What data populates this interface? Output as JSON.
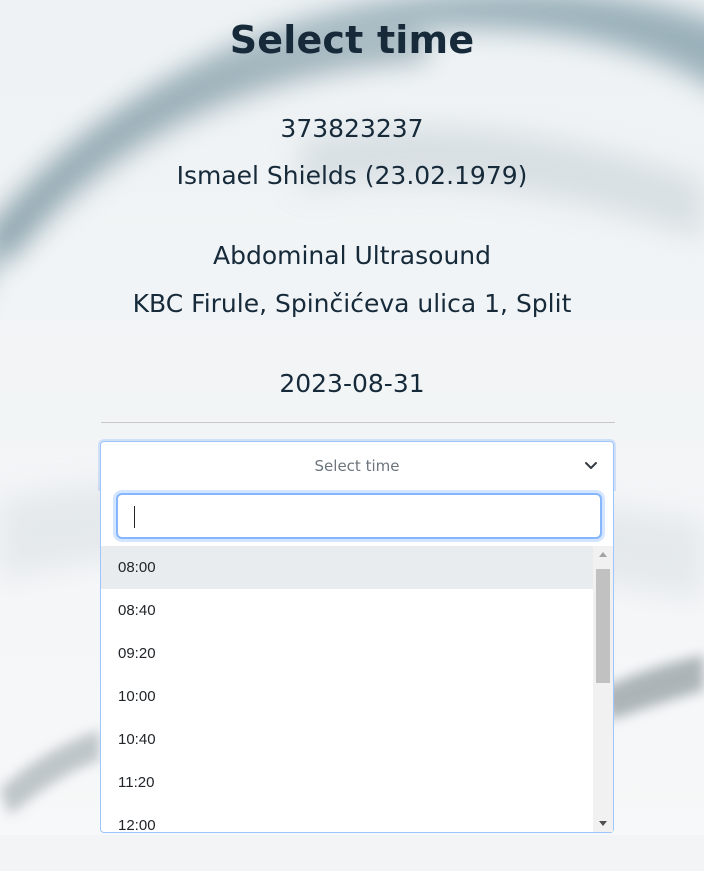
{
  "header": {
    "title": "Select time",
    "patient_id": "373823237",
    "patient_name_dob": "Ismael Shields (23.02.1979)",
    "procedure": "Abdominal Ultrasound",
    "location": "KBC Firule, Spinčićeva ulica 1, Split",
    "date": "2023-08-31"
  },
  "time_select": {
    "placeholder": "Select time",
    "search_value": "",
    "options": [
      "08:00",
      "08:40",
      "09:20",
      "10:00",
      "10:40",
      "11:20",
      "12:00"
    ],
    "highlighted_option": "08:00"
  },
  "colors": {
    "title_text": "#162a3a",
    "focus_border": "#86b7fe",
    "highlight_bg": "#e9ecef"
  },
  "icons": {
    "dropdown_toggle": "chevron-down-icon",
    "scroll_up": "triangle-up-icon",
    "scroll_down": "triangle-down-icon"
  }
}
